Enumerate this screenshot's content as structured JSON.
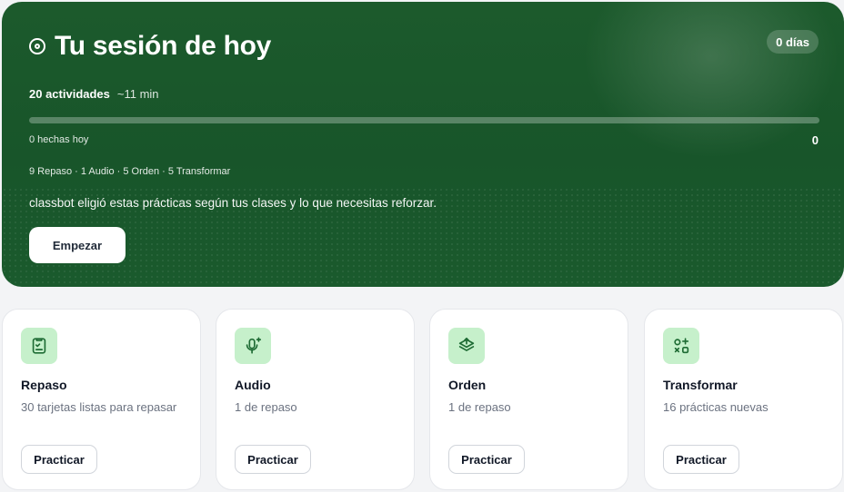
{
  "session": {
    "title": "Tu sesión de hoy",
    "streak": "0 días",
    "activities": "20 actividades",
    "duration": "~11 min",
    "progress_fraction": 0,
    "done_label": "0 hechas hoy",
    "done_count": "0",
    "breakdown": "9 Repaso · 1 Audio · 5 Orden · 5 Transformar",
    "explanation": "classbot eligió estas prácticas según tus clases y lo que necesitas reforzar.",
    "start_label": "Empezar"
  },
  "cards": [
    {
      "icon": "flashcards-icon",
      "title": "Repaso",
      "subtitle": "30 tarjetas listas para repasar",
      "button": "Practicar"
    },
    {
      "icon": "microphone-sparkle-icon",
      "title": "Audio",
      "subtitle": "1 de repaso",
      "button": "Practicar"
    },
    {
      "icon": "layers-stack-icon",
      "title": "Orden",
      "subtitle": "1 de repaso",
      "button": "Practicar"
    },
    {
      "icon": "shapes-transform-icon",
      "title": "Transformar",
      "subtitle": "16 prácticas nuevas",
      "button": "Practicar"
    }
  ],
  "colors": {
    "hero": "#1c5a2c",
    "icon_bg": "#c6f0cb",
    "icon_stroke": "#1e6b34"
  }
}
